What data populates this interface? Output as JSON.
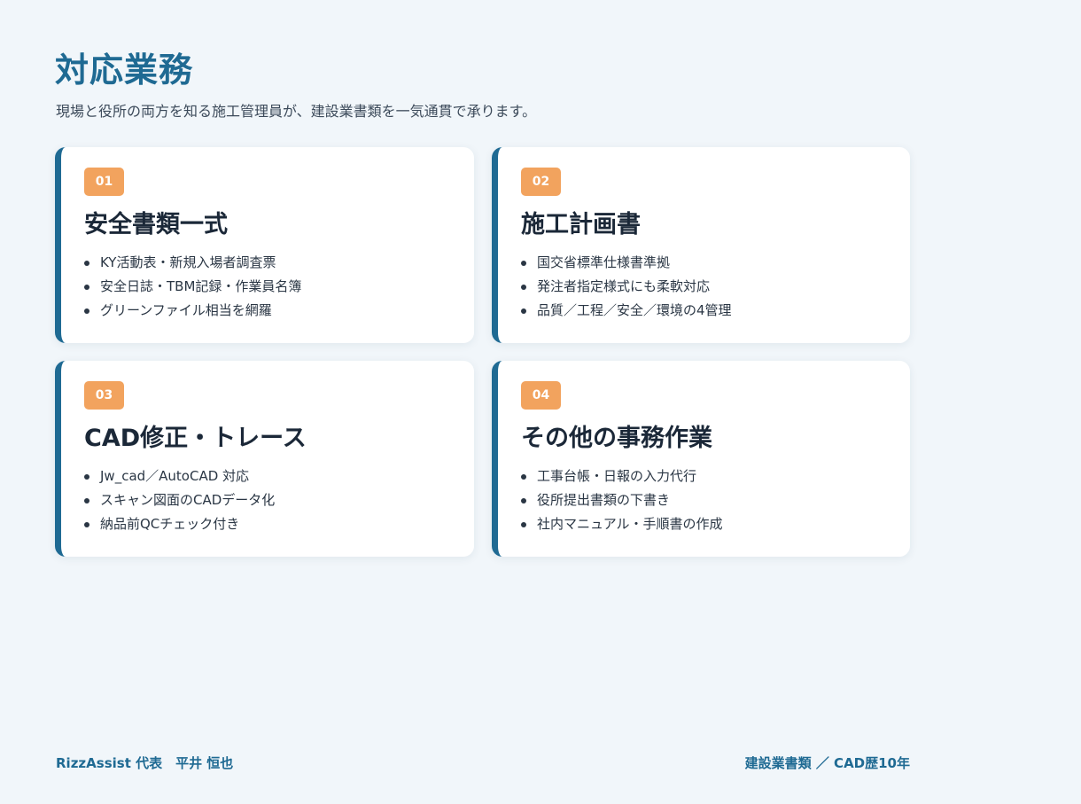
{
  "header": {
    "title": "対応業務",
    "subtitle": "現場と役所の両方を知る施工管理員が、建設業書類を一気通貫で承ります。"
  },
  "cards": [
    {
      "number": "01",
      "title": "安全書類一式",
      "items": [
        "KY活動表・新規入場者調査票",
        "安全日誌・TBM記録・作業員名簿",
        "グリーンファイル相当を網羅"
      ]
    },
    {
      "number": "02",
      "title": "施工計画書",
      "items": [
        "国交省標準仕様書準拠",
        "発注者指定様式にも柔軟対応",
        "品質／工程／安全／環境の4管理"
      ]
    },
    {
      "number": "03",
      "title": "CAD修正・トレース",
      "items": [
        "Jw_cad／AutoCAD 対応",
        "スキャン図面のCADデータ化",
        "納品前QCチェック付き"
      ]
    },
    {
      "number": "04",
      "title": "その他の事務作業",
      "items": [
        "工事台帳・日報の入力代行",
        "役所提出書類の下書き",
        "社内マニュアル・手順書の作成"
      ]
    }
  ],
  "footer": {
    "left": "RizzAssist 代表　平井 恒也",
    "right": "建設業書類 ／ CAD歴10年"
  },
  "colors": {
    "accent": "#1f6a93",
    "badge": "#f2a35e",
    "background": "#f1f6fa"
  }
}
